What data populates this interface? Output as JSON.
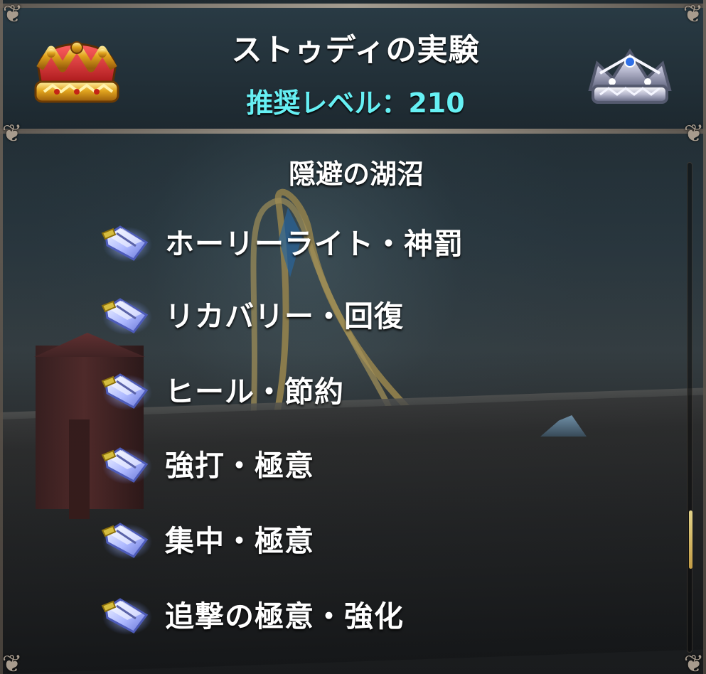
{
  "header": {
    "title": "ストゥディの実験",
    "recommended_level_label": "推奨レベル",
    "recommended_level_separator": "：",
    "recommended_level_value": "210",
    "left_icon": "gold-crown-icon",
    "right_icon": "silver-crown-icon"
  },
  "content": {
    "section_title": "隠避の湖沼",
    "items": [
      {
        "icon": "skill-book-icon",
        "label": "ホーリーライト・神罰"
      },
      {
        "icon": "skill-book-icon",
        "label": "リカバリー・回復"
      },
      {
        "icon": "skill-book-icon",
        "label": "ヒール・節約"
      },
      {
        "icon": "skill-book-icon",
        "label": "強打・極意"
      },
      {
        "icon": "skill-book-icon",
        "label": "集中・極意"
      },
      {
        "icon": "skill-book-icon",
        "label": "追撃の極意・強化"
      }
    ]
  },
  "scrollbar": {
    "position": 0.82
  },
  "colors": {
    "title": "#ffffff",
    "level": "#66f0f4",
    "frame": "#a79b8d",
    "scroll_thumb": "#d8bd61"
  }
}
